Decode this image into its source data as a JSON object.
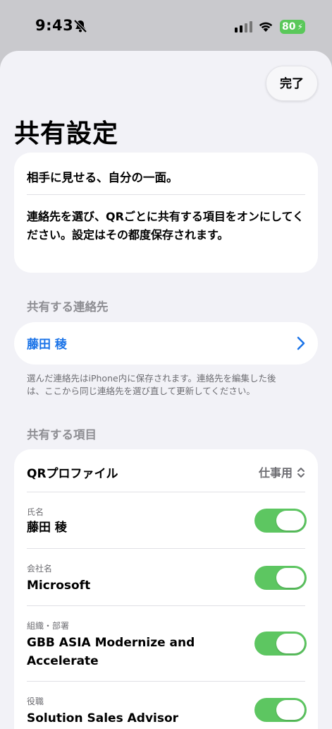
{
  "status_bar": {
    "time": "9:43",
    "battery": "80",
    "battery_color": "#5ac85a"
  },
  "sheet": {
    "done_label": "完了",
    "title": "共有設定",
    "intro": {
      "heading": "相手に見せる、自分の一面。",
      "body": "連絡先を選び、QRごとに共有する項目をオンにしてください。設定はその都度保存されます。"
    },
    "contact_section": {
      "header": "共有する連絡先",
      "name": "藤田 稜",
      "footnote": "選んだ連絡先はiPhone内に保存されます。連絡先を編集した後は、ここから同じ連絡先を選び直して更新してください。"
    },
    "items_section": {
      "header": "共有する項目",
      "qr_profile_label": "QRプロファイル",
      "qr_profile_value": "仕事用",
      "rows": [
        {
          "label": "氏名",
          "value": "藤田 稜",
          "enabled": true
        },
        {
          "label": "会社名",
          "value": "Microsoft",
          "enabled": true
        },
        {
          "label": "組織・部署",
          "value": "GBB ASIA Modernize and Accelerate",
          "enabled": true
        },
        {
          "label": "役職",
          "value": "Solution Sales Advisor",
          "enabled": true
        }
      ]
    }
  },
  "colors": {
    "accent": "#1a73e8",
    "toggle_on": "#5dc661",
    "background": "#f2f2f7"
  }
}
